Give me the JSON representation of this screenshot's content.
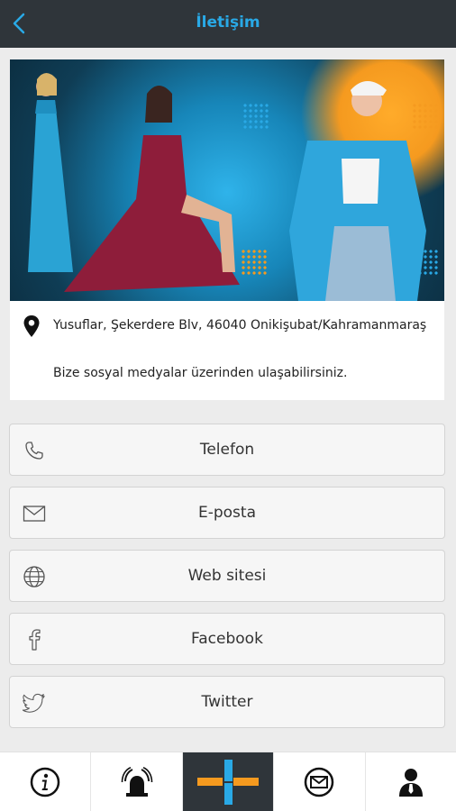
{
  "header": {
    "title": "İletişim",
    "back_icon": "chevron-left-icon",
    "accent": "#29a9e6",
    "background": "#2f353a"
  },
  "banner": {
    "image": "fashion-models-banner",
    "colors": {
      "primary": "#1786b9",
      "secondary": "#f59a1f"
    }
  },
  "contact": {
    "address": "Yusuflar, Şekerdere Blv, 46040 Onikişubat/Kahramanmaraş",
    "address_icon": "location-pin-icon",
    "social_text": "Bize sosyal medyalar üzerinden ulaşabilirsiniz."
  },
  "buttons": [
    {
      "label": "Telefon",
      "icon": "phone-icon"
    },
    {
      "label": "E-posta",
      "icon": "envelope-icon"
    },
    {
      "label": "Web sitesi",
      "icon": "globe-icon"
    },
    {
      "label": "Facebook",
      "icon": "facebook-icon"
    },
    {
      "label": "Twitter",
      "icon": "twitter-icon"
    }
  ],
  "bottom_nav": [
    {
      "icon": "info-icon",
      "active": false
    },
    {
      "icon": "alarm-bell-icon",
      "active": false
    },
    {
      "icon": "home-cross-icon",
      "active": true
    },
    {
      "icon": "mail-icon",
      "active": false
    },
    {
      "icon": "user-icon",
      "active": false
    }
  ]
}
